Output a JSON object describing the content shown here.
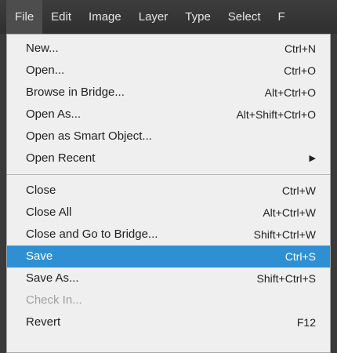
{
  "menubar": {
    "items": [
      {
        "label": "File",
        "active": true
      },
      {
        "label": "Edit"
      },
      {
        "label": "Image"
      },
      {
        "label": "Layer"
      },
      {
        "label": "Type"
      },
      {
        "label": "Select"
      },
      {
        "label": "F"
      }
    ]
  },
  "menu": {
    "group1": [
      {
        "label": "New...",
        "shortcut": "Ctrl+N"
      },
      {
        "label": "Open...",
        "shortcut": "Ctrl+O"
      },
      {
        "label": "Browse in Bridge...",
        "shortcut": "Alt+Ctrl+O"
      },
      {
        "label": "Open As...",
        "shortcut": "Alt+Shift+Ctrl+O"
      },
      {
        "label": "Open as Smart Object...",
        "shortcut": ""
      },
      {
        "label": "Open Recent",
        "shortcut": "",
        "submenu_icon": "triangle-right-icon"
      }
    ],
    "group2": [
      {
        "label": "Close",
        "shortcut": "Ctrl+W"
      },
      {
        "label": "Close All",
        "shortcut": "Alt+Ctrl+W"
      },
      {
        "label": "Close and Go to Bridge...",
        "shortcut": "Shift+Ctrl+W"
      },
      {
        "label": "Save",
        "shortcut": "Ctrl+S",
        "highlighted": true
      },
      {
        "label": "Save As...",
        "shortcut": "Shift+Ctrl+S"
      },
      {
        "label": "Check In...",
        "shortcut": "",
        "disabled": true
      },
      {
        "label": "Revert",
        "shortcut": "F12"
      }
    ]
  },
  "colors": {
    "highlight": "#2f8fd3",
    "menu_bg": "#efefef",
    "menubar_bg": "#3a3a3a"
  }
}
